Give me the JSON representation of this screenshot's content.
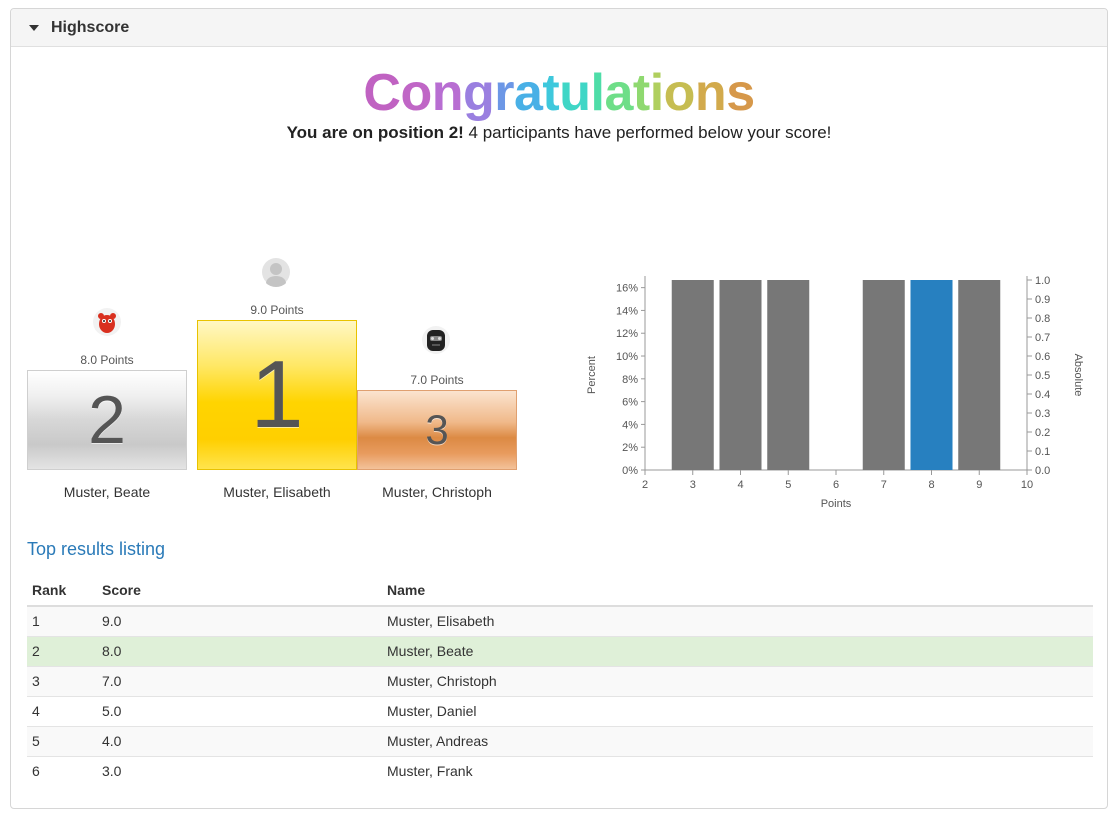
{
  "panel": {
    "title": "Highscore"
  },
  "congrats": {
    "letters": [
      "C",
      "o",
      "n",
      "g",
      "r",
      "a",
      "t",
      "u",
      "l",
      "a",
      "t",
      "i",
      "o",
      "n",
      "s"
    ],
    "colors": [
      "#c062c2",
      "#c066c6",
      "#b86ed2",
      "#9a7fe0",
      "#6c97e6",
      "#49b0e6",
      "#3ec8dc",
      "#3fd6c6",
      "#4edda8",
      "#6ede88",
      "#8fd970",
      "#b0cf5e",
      "#c6bd52",
      "#d2aa4c",
      "#d6984a"
    ],
    "subline_bold": "You are on position 2!",
    "subline_rest": " 4 participants have performed below your score!"
  },
  "podium": [
    {
      "place": "2",
      "points": "8.0 Points",
      "name": "Muster, Beate",
      "avatar": "red-monster-avatar"
    },
    {
      "place": "1",
      "points": "9.0 Points",
      "name": "Muster, Elisabeth",
      "avatar": "default-user-avatar"
    },
    {
      "place": "3",
      "points": "7.0 Points",
      "name": "Muster, Christoph",
      "avatar": "dark-robot-avatar"
    }
  ],
  "chart_data": {
    "type": "bar",
    "xlabel": "Points",
    "ylabel": "Percent",
    "y2label": "Absolute",
    "x_ticks": [
      "2",
      "3",
      "4",
      "5",
      "6",
      "7",
      "8",
      "9",
      "10"
    ],
    "xlim": [
      2,
      10
    ],
    "ylim": [
      0,
      0.1667
    ],
    "y_ticks": [
      "0%",
      "2%",
      "4%",
      "6%",
      "8%",
      "10%",
      "12%",
      "14%",
      "16%"
    ],
    "y2lim": [
      0,
      1
    ],
    "y2_ticks": [
      "0.0",
      "0.1",
      "0.2",
      "0.3",
      "0.4",
      "0.5",
      "0.6",
      "0.7",
      "0.8",
      "0.9",
      "1.0"
    ],
    "categories": [
      "3",
      "4",
      "5",
      "6",
      "7",
      "8",
      "9"
    ],
    "values_percent": [
      16.67,
      16.67,
      16.67,
      0,
      16.67,
      16.67,
      16.67
    ],
    "values_absolute": [
      1,
      1,
      1,
      0,
      1,
      1,
      1
    ],
    "highlight_category": "8",
    "bar_color": "#777777",
    "highlight_color": "#2780c0"
  },
  "listing": {
    "title": "Top results listing",
    "headers": [
      "Rank",
      "Score",
      "Name"
    ],
    "rows": [
      {
        "rank": "1",
        "score": "9.0",
        "name": "Muster, Elisabeth"
      },
      {
        "rank": "2",
        "score": "8.0",
        "name": "Muster, Beate"
      },
      {
        "rank": "3",
        "score": "7.0",
        "name": "Muster, Christoph"
      },
      {
        "rank": "4",
        "score": "5.0",
        "name": "Muster, Daniel"
      },
      {
        "rank": "5",
        "score": "4.0",
        "name": "Muster, Andreas"
      },
      {
        "rank": "6",
        "score": "3.0",
        "name": "Muster, Frank"
      }
    ],
    "highlight_rank": "2"
  }
}
